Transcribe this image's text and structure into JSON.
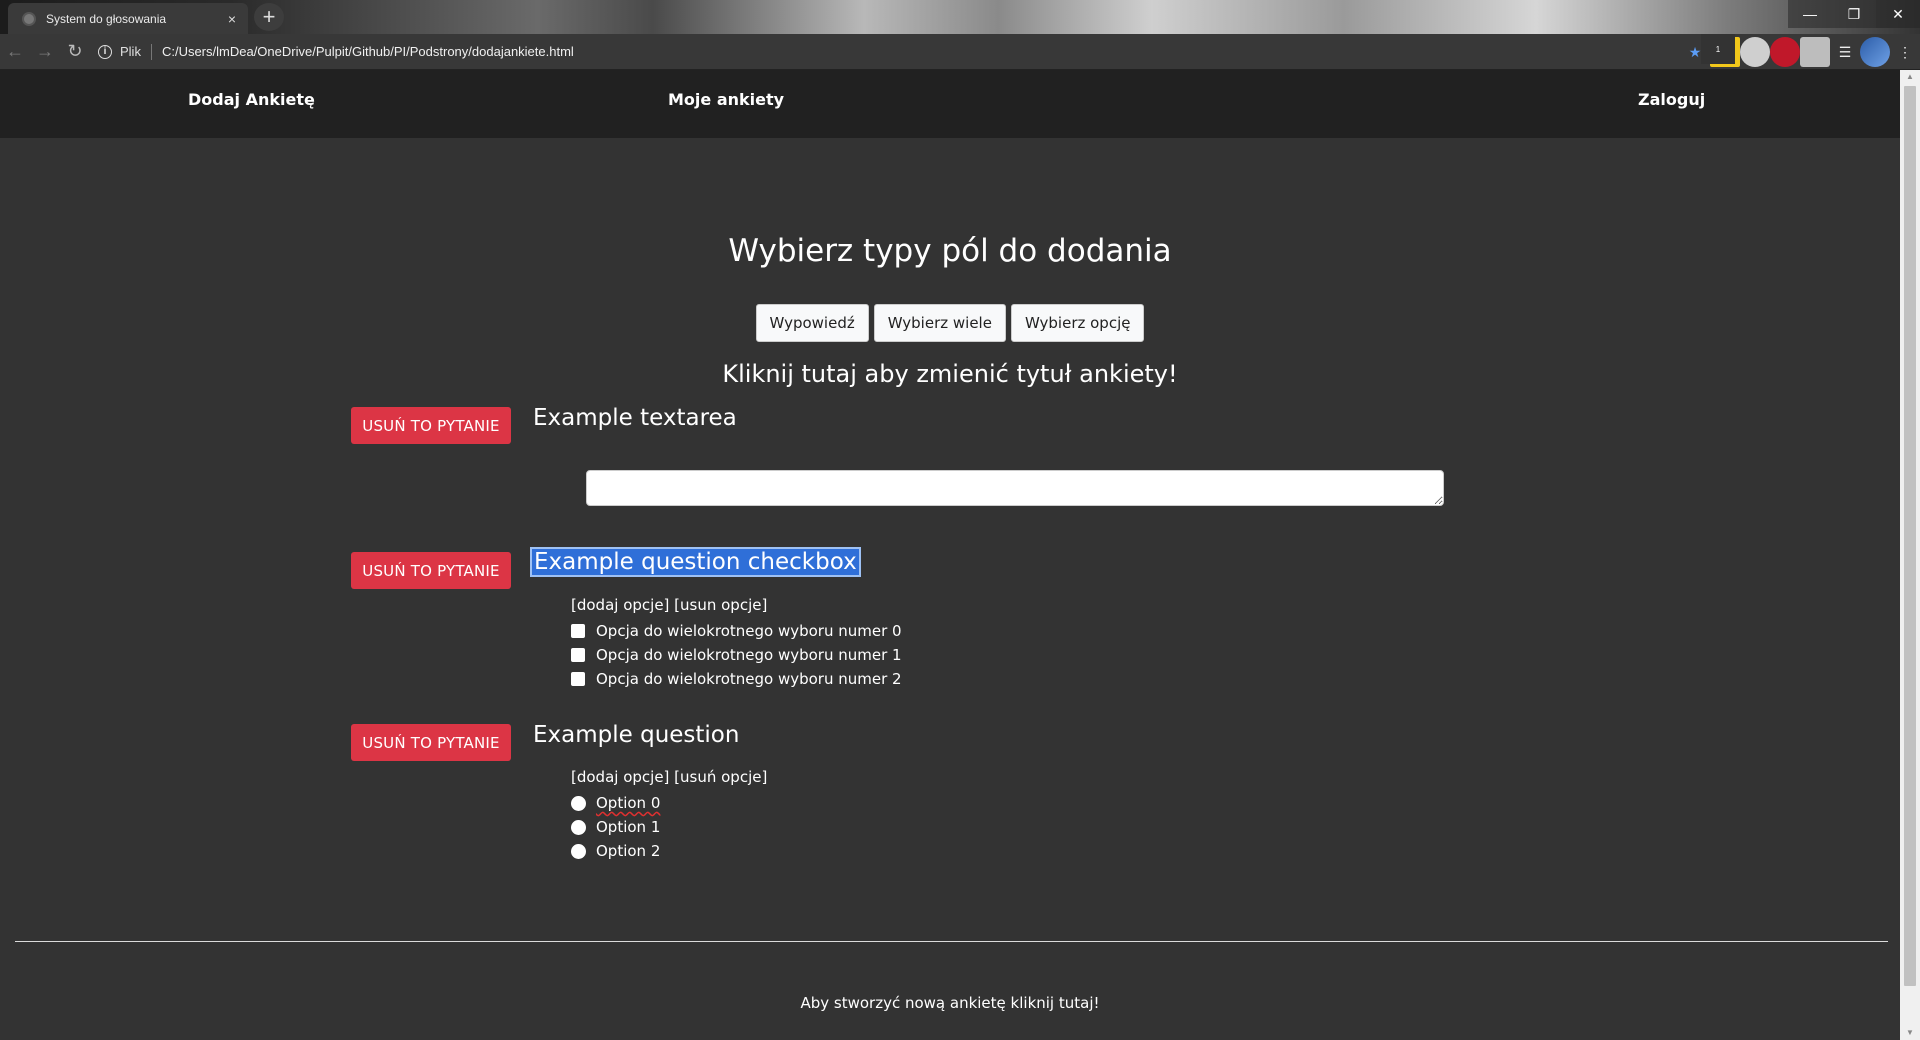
{
  "browser": {
    "tab_title": "System do głosowania",
    "tab_close": "×",
    "new_tab": "+",
    "scheme_label": "Plik",
    "url": "C:/Users/lmDea/OneDrive/Pulpit/Github/PI/Podstrony/dodajankiete.html",
    "extension_badge": "1",
    "window_controls": [
      "—",
      "❐",
      "✕"
    ]
  },
  "nav": {
    "add_survey": "Dodaj Ankietę",
    "my_surveys": "Moje ankiety",
    "login": "Zaloguj"
  },
  "builder": {
    "heading": "Wybierz typy pól do dodania",
    "type_buttons": [
      "Wypowiedź",
      "Wybierz wiele",
      "Wybierz opcję"
    ],
    "survey_title": "Kliknij tutaj aby zmienić tytuł ankiety!"
  },
  "questions": [
    {
      "delete_label": "USUŃ TO PYTANIE",
      "title": "Example textarea",
      "answer_value": ""
    },
    {
      "delete_label": "USUŃ TO PYTANIE",
      "title": "Example question checkbox",
      "selected": true,
      "option_controls": "[dodaj opcje] [usun opcje]",
      "options": [
        "Opcja do wielokrotnego wyboru numer 0",
        "Opcja do wielokrotnego wyboru numer 1",
        "Opcja do wielokrotnego wyboru numer 2"
      ]
    },
    {
      "delete_label": "USUŃ TO PYTANIE",
      "title": "Example question",
      "option_controls": "[dodaj opcje] [usuń opcje]",
      "options": [
        "Option 0",
        "Option 1",
        "Option 2"
      ]
    }
  ],
  "footer": {
    "text": "Aby stworzyć nową ankietę kliknij tutaj!"
  },
  "colors": {
    "page_bg": "#333333",
    "nav_bg": "#212121",
    "danger": "#dc3545",
    "selection": "#2f6fd8"
  }
}
